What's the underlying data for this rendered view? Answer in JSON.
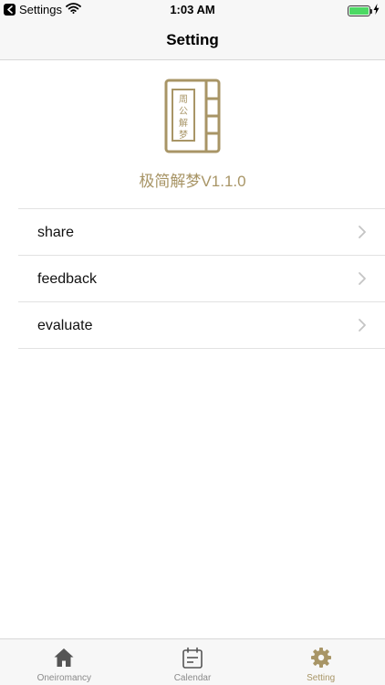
{
  "status_bar": {
    "back_app": "Settings",
    "time": "1:03 AM"
  },
  "nav": {
    "title": "Setting"
  },
  "app": {
    "logo_text": [
      "周",
      "公",
      "解",
      "梦"
    ],
    "version": "极简解梦V1.1.0"
  },
  "menu": {
    "items": [
      {
        "label": "share"
      },
      {
        "label": "feedback"
      },
      {
        "label": "evaluate"
      }
    ]
  },
  "tabs": {
    "items": [
      {
        "label": "Oneiromancy",
        "icon": "home-icon"
      },
      {
        "label": "Calendar",
        "icon": "calendar-icon"
      },
      {
        "label": "Setting",
        "icon": "gear-icon",
        "active": true
      }
    ]
  },
  "colors": {
    "accent": "#a89566",
    "inactive_tab": "#555555",
    "battery": "#4cd964"
  }
}
